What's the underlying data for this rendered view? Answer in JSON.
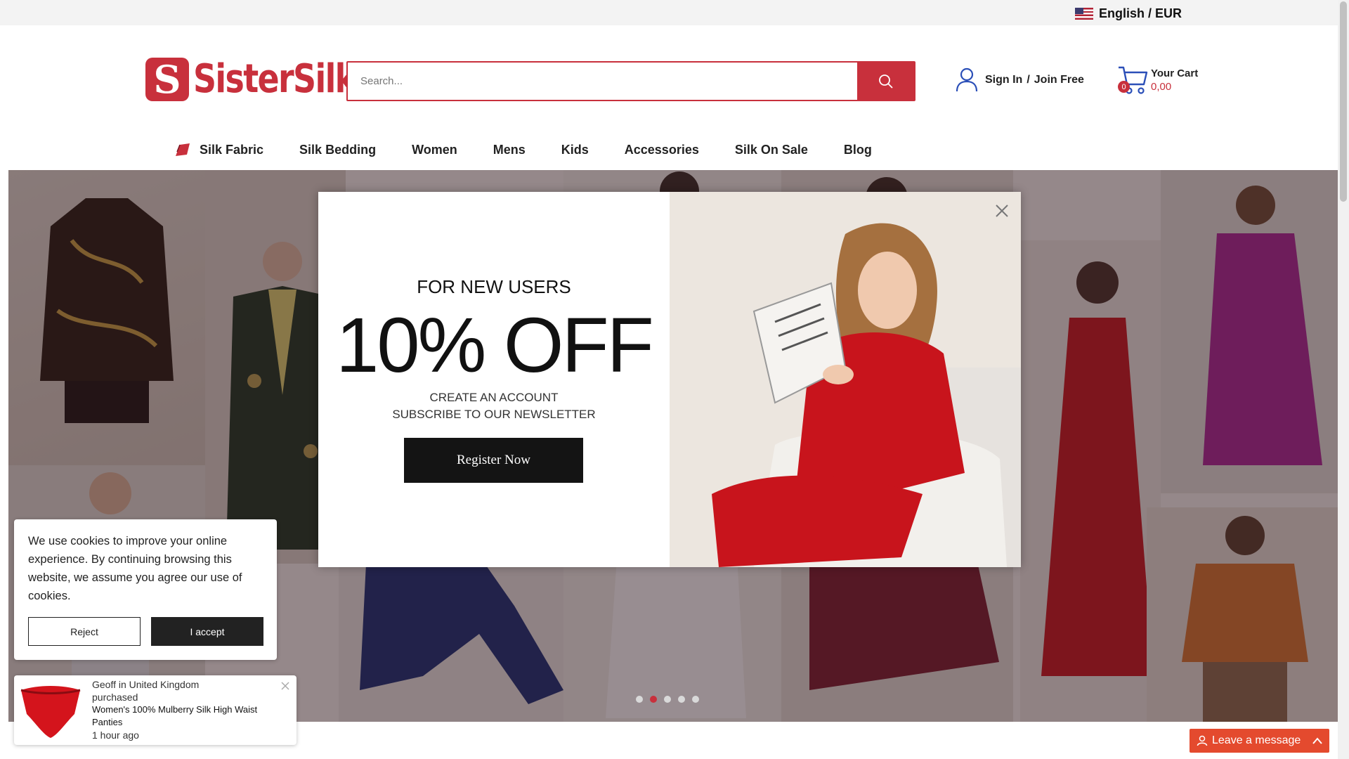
{
  "topbar": {
    "language_currency": "English / EUR",
    "flag_icon": "us-flag-icon"
  },
  "header": {
    "logo_text": "SisterSilk",
    "logo_mark": "S",
    "search": {
      "placeholder": "Search..."
    },
    "sign_in": "Sign In",
    "separator": "/",
    "join_free": "Join Free",
    "cart": {
      "title": "Your Cart",
      "total": "0,00",
      "count": "0"
    }
  },
  "nav": {
    "items": [
      {
        "label": "Silk Fabric"
      },
      {
        "label": "Silk Bedding"
      },
      {
        "label": "Women"
      },
      {
        "label": "Mens"
      },
      {
        "label": "Kids"
      },
      {
        "label": "Accessories"
      },
      {
        "label": "Silk On Sale"
      },
      {
        "label": "Blog"
      }
    ]
  },
  "hero": {
    "slides_total": 5,
    "active_slide": 2
  },
  "modal": {
    "kicker": "FOR NEW USERS",
    "headline": "10% OFF",
    "line1": "CREATE AN ACCOUNT",
    "line2": "SUBSCRIBE TO OUR NEWSLETTER",
    "button": "Register Now"
  },
  "cookie": {
    "text": "We use cookies to improve your online experience. By continuing browsing this website, we assume you agree our use of cookies.",
    "reject": "Reject",
    "accept": "I accept"
  },
  "purchase_notice": {
    "who": "Geoff in United Kingdom",
    "action": "purchased",
    "product": "Women's 100% Mulberry Silk High Waist Panties",
    "time": "1 hour ago"
  },
  "chat": {
    "label": "Leave a message"
  },
  "colors": {
    "brand": "#c8303c",
    "chat": "#e44a2e"
  }
}
